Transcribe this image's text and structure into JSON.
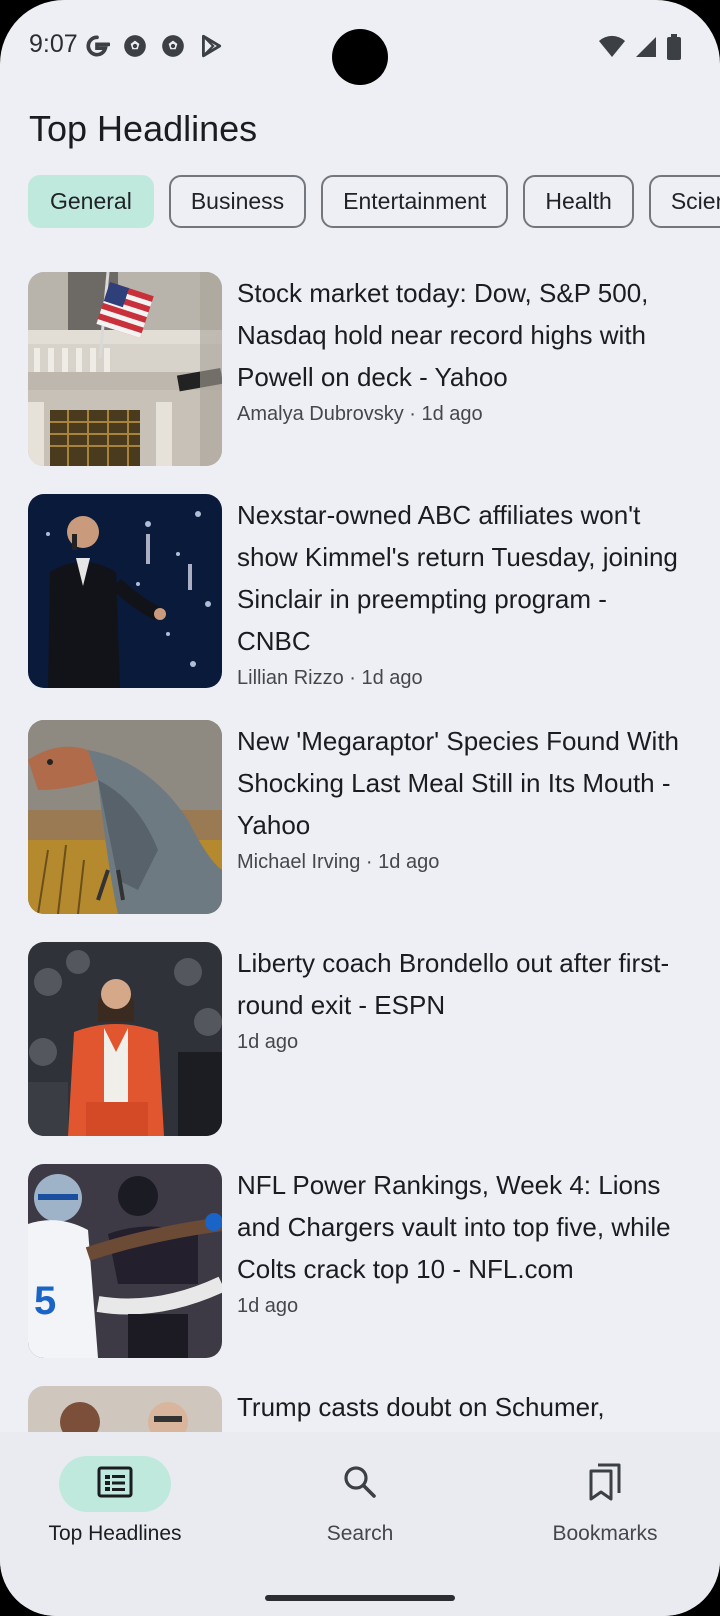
{
  "status_bar": {
    "time": "9:07",
    "left_icons": [
      "google-icon",
      "soccer-ball-icon",
      "soccer-ball-icon",
      "play-store-icon"
    ],
    "right_icons": [
      "wifi-icon",
      "cellular-signal-icon",
      "battery-icon"
    ]
  },
  "header": {
    "title": "Top Headlines"
  },
  "categories": [
    {
      "label": "General",
      "selected": true
    },
    {
      "label": "Business",
      "selected": false
    },
    {
      "label": "Entertainment",
      "selected": false
    },
    {
      "label": "Health",
      "selected": false
    },
    {
      "label": "Science",
      "selected": false
    }
  ],
  "articles": [
    {
      "headline": "Stock market today: Dow, S&P 500, Nasdaq hold near record highs with Powell on deck - Yahoo",
      "meta": "Amalya Dubrovsky · 1d ago",
      "image": "new-york-stock-exchange-photo"
    },
    {
      "headline": "Nexstar-owned ABC affiliates won't show Kimmel's return Tuesday, joining Sinclair in preempting program - CNBC",
      "meta": "Lillian Rizzo · 1d ago",
      "image": "kimmel-on-stage-photo"
    },
    {
      "headline": "New 'Megaraptor' Species Found With Shocking Last Meal Still in Its Mouth - Yahoo",
      "meta": "Michael Irving · 1d ago",
      "image": "megaraptor-illustration"
    },
    {
      "headline": "Liberty coach Brondello out after first-round exit - ESPN",
      "meta": "1d ago",
      "image": "coach-courtside-photo"
    },
    {
      "headline": "NFL Power Rankings, Week 4: Lions and Chargers vault into top five, while Colts crack top 10 - NFL.com",
      "meta": "1d ago",
      "image": "football-players-photo"
    },
    {
      "headline": "Trump casts doubt on Schumer,",
      "meta": "",
      "image": "politicians-photo"
    }
  ],
  "bottom_nav": [
    {
      "label": "Top Headlines",
      "icon": "newspaper-icon",
      "active": true
    },
    {
      "label": "Search",
      "icon": "search-icon",
      "active": false
    },
    {
      "label": "Bookmarks",
      "icon": "bookmarks-icon",
      "active": false
    }
  ],
  "colors": {
    "background": "#edeff5",
    "accent_container": "#bfe9dd",
    "nav_background": "#e9ebf0"
  }
}
